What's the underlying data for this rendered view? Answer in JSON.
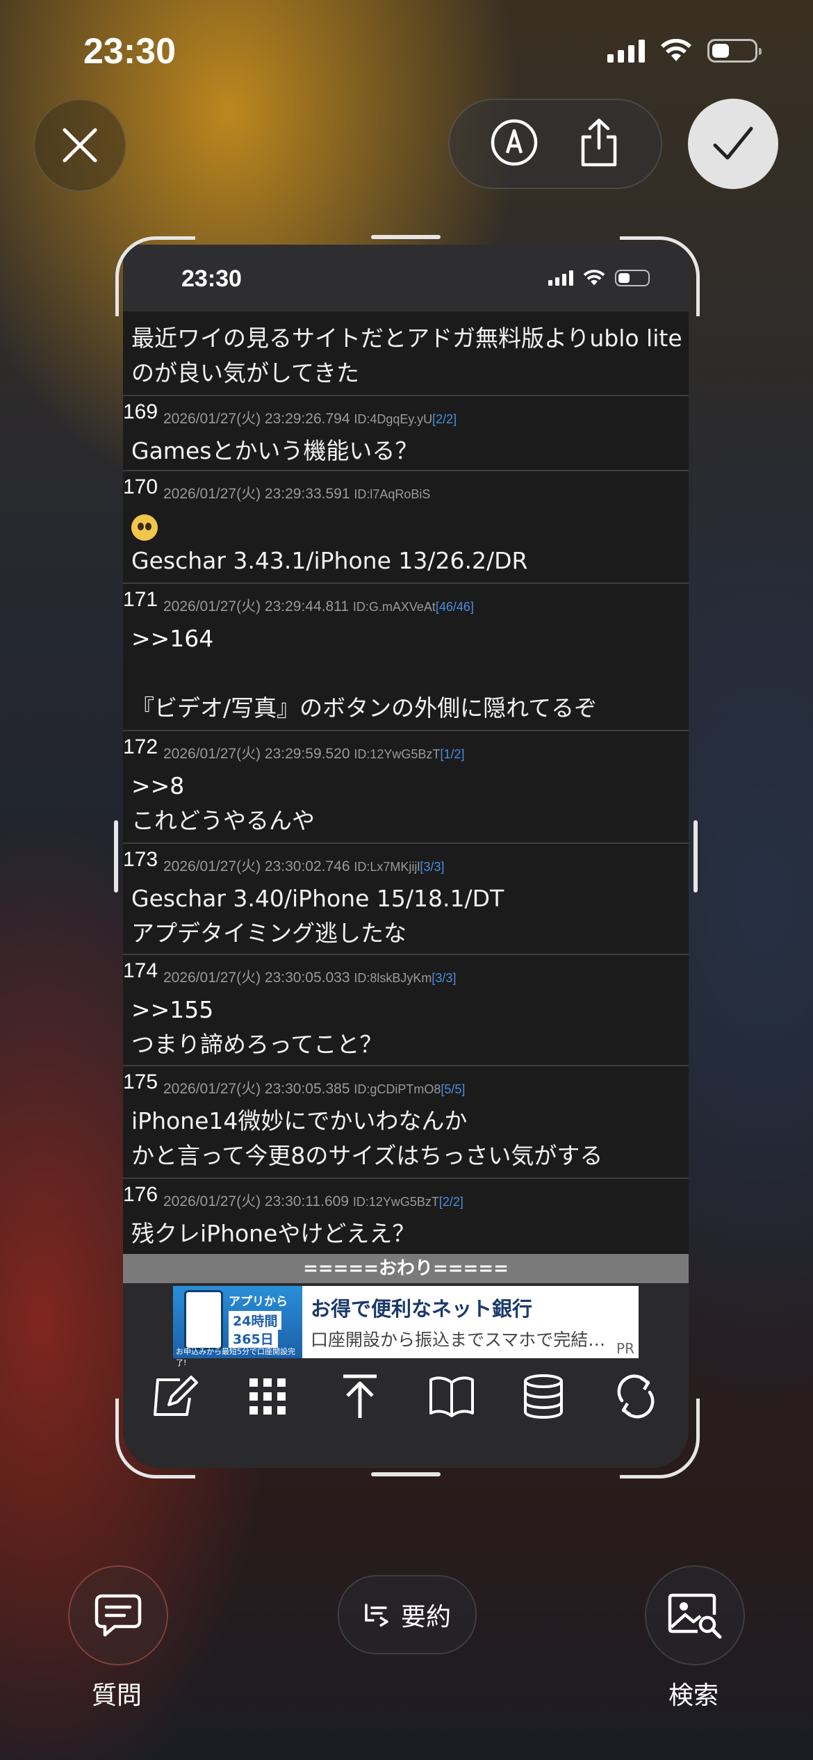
{
  "status_bar": {
    "time": "23:30"
  },
  "top_actions": {
    "close": "close",
    "markup": "markup",
    "share": "share",
    "done": "done"
  },
  "screenshot": {
    "status_time": "23:30",
    "posts": [
      {
        "number": "",
        "date": "",
        "id": "",
        "count": "",
        "lines": [
          "最近ワイの見るサイトだとアドガ無料版よりublo lite",
          "のが良い気がしてきた"
        ]
      },
      {
        "number": "169",
        "date": "2026/01/27(火) 23:29:26.794",
        "id": "ID:4DgqEy.yU",
        "count": "[2/2]",
        "lines": [
          "Gamesとかいう機能いる？"
        ]
      },
      {
        "number": "170",
        "date": "2026/01/27(火) 23:29:33.591",
        "id": "ID:l7AqRoBiS",
        "count": "",
        "lines": [
          "",
          "Geschar 3.43.1/iPhone 13/26.2/DR"
        ]
      },
      {
        "number": "171",
        "date": "2026/01/27(火) 23:29:44.811",
        "id": "ID:G.mAXVeAt",
        "count": "[46/46]",
        "lines": [
          ">>164",
          "",
          "『ビデオ/写真』のボタンの外側に隠れてるぞ"
        ]
      },
      {
        "number": "172",
        "date": "2026/01/27(火) 23:29:59.520",
        "id": "ID:12YwG5BzT",
        "count": "[1/2]",
        "lines": [
          ">>8",
          "これどうやるんや"
        ]
      },
      {
        "number": "173",
        "date": "2026/01/27(火) 23:30:02.746",
        "id": "ID:Lx7MKjijl",
        "count": "[3/3]",
        "lines": [
          "Geschar 3.40/iPhone 15/18.1/DT",
          "アプデタイミング逃したな"
        ]
      },
      {
        "number": "174",
        "date": "2026/01/27(火) 23:30:05.033",
        "id": "ID:8lskBJyKm",
        "count": "[3/3]",
        "lines": [
          ">>155",
          "つまり諦めろってこと？"
        ]
      },
      {
        "number": "175",
        "date": "2026/01/27(火) 23:30:05.385",
        "id": "ID:gCDiPTmO8",
        "count": "[5/5]",
        "lines": [
          "iPhone14微妙にでかいわなんか",
          "かと言って今更8のサイズはちっさい気がする"
        ]
      },
      {
        "number": "176",
        "date": "2026/01/27(火) 23:30:11.609",
        "id": "ID:12YwG5BzT",
        "count": "[2/2]",
        "lines": [
          "残クレiPhoneやけどええ？"
        ]
      }
    ],
    "end_marker": "=====おわり=====",
    "ad": {
      "img_line1": "アプリから",
      "img_line2": "24時間",
      "img_line3": "365日",
      "img_line4": "お申込みから最短5分で口座開設完了!",
      "title": "お得で便利なネット銀行",
      "subtitle": "口座開設から振込までスマホで完結…",
      "pr": "PR"
    },
    "toolbar_icons": [
      "compose-icon",
      "grid-icon",
      "scroll-top-icon",
      "book-icon",
      "database-icon",
      "refresh-icon"
    ]
  },
  "bottom_actions": {
    "ask_label": "質問",
    "summary_label": "要約",
    "search_label": "検索"
  }
}
